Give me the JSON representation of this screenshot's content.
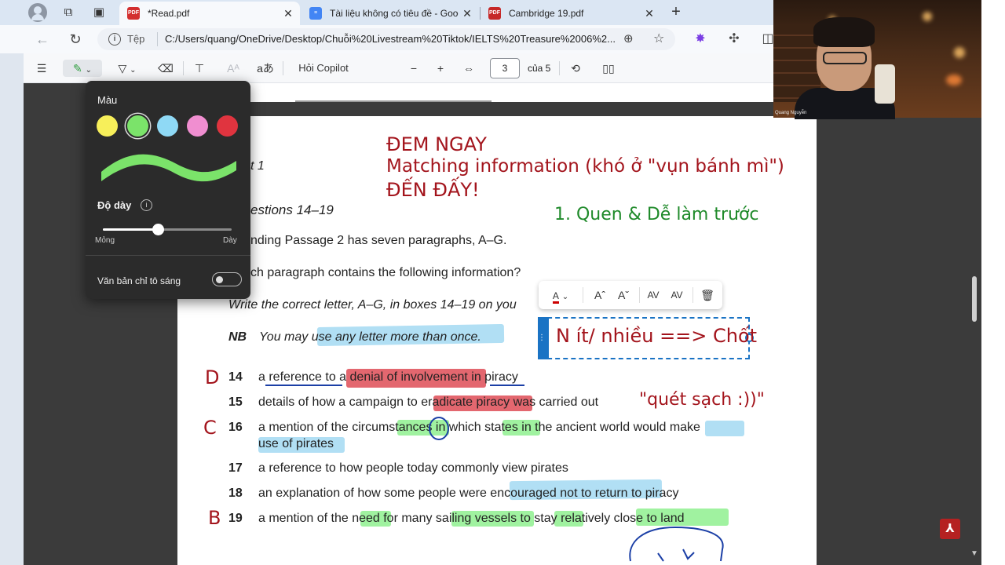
{
  "browser": {
    "tabs": [
      {
        "title": "*Read.pdf",
        "favicon": "pdf-icon",
        "active": true
      },
      {
        "title": "Tài liệu không có tiêu đề - Google",
        "favicon": "docs-icon",
        "active": false
      },
      {
        "title": "Cambridge 19.pdf",
        "favicon": "pdf-icon",
        "active": false
      }
    ],
    "site_label": "Tệp",
    "url": "C:/Users/quang/OneDrive/Desktop/Chuỗi%20Livestream%20Tiktok/IELTS%20Treasure%2006%2..."
  },
  "pdf_toolbar": {
    "ask_copilot": "Hỏi Copilot",
    "read_aloud_glyph": "aあ",
    "current_page": "3",
    "total_pages": "của 5",
    "zoom_out": "−",
    "zoom_in": "+"
  },
  "highlight_panel": {
    "color_label": "Màu",
    "colors": [
      "#f7ef5a",
      "#7be36a",
      "#8fd9f5",
      "#f08ed0",
      "#e0343f"
    ],
    "selected_color_index": 1,
    "thickness_label": "Độ dày",
    "thickness_value": 0.43,
    "slider_min_label": "Mỏng",
    "slider_max_label": "Dày",
    "highlight_text_only_label": "Văn bản chỉ tô sáng",
    "highlight_text_only_enabled": false
  },
  "page": {
    "part_label": "t 1",
    "questions_label": "estions 14–19",
    "intro_line": "nding Passage 2 has seven paragraphs, A–G.",
    "question_line": "ch paragraph contains the following information?",
    "instruction": "Write the correct letter, A–G, in boxes 14–19 on you",
    "nb_label": "NB",
    "nb_text": "You may use any letter more than once.",
    "items": [
      {
        "num": "14",
        "text": "a reference to a denial of involvement in piracy"
      },
      {
        "num": "15",
        "text": "details of how a campaign to eradicate piracy was carried out"
      },
      {
        "num": "16",
        "text": "a mention of the circumstances in which states in the ancient world would make",
        "text2": "use of pirates"
      },
      {
        "num": "17",
        "text": "a reference to how people today commonly view pirates"
      },
      {
        "num": "18",
        "text": "an explanation of how some people were encouraged not to return to piracy"
      },
      {
        "num": "19",
        "text": "a mention of the need for many sailing vessels to stay relatively close to land"
      }
    ]
  },
  "annotations": {
    "heading_line1": "ĐEM NGAY",
    "heading_line2": "Matching information (khó ở \"vụn bánh mì\")",
    "heading_line3": "ĐẾN ĐẤY!",
    "tip": "1. Quen & Dễ làm trước",
    "textbox": "N ít/ nhiều ==> Chốt",
    "note_15": "\"quét sạch :))\"",
    "letter_14": "D",
    "letter_16": "C",
    "letter_19": "B"
  },
  "webcam": {
    "name": "Quang Nguyễn"
  },
  "colors": {
    "annotation_red": "#a3141c",
    "annotation_green": "#1f8a2a",
    "highlight_green": "#8ff08f",
    "highlight_blue": "#a8dcf3",
    "highlight_red": "#e0565f"
  }
}
